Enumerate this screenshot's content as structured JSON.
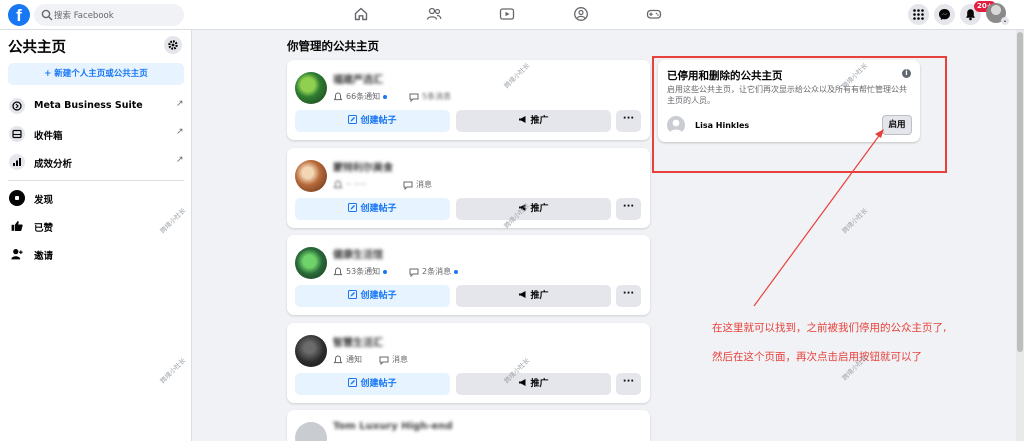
{
  "header": {
    "search_placeholder": "搜索 Facebook",
    "notification_badge": "20+"
  },
  "sidebar": {
    "title": "公共主页",
    "new_page_label": "+ 新建个人主页或公共主页",
    "items": [
      {
        "label": "Meta Business Suite",
        "arrow": "↗"
      },
      {
        "label": "收件箱",
        "arrow": "↗"
      },
      {
        "label": "成效分析",
        "arrow": "↗"
      },
      {
        "label": "发现"
      },
      {
        "label": "已赞"
      },
      {
        "label": "邀请"
      }
    ]
  },
  "main": {
    "title": "你管理的公共主页",
    "create_post_label": "创建帖子",
    "promote_label": "推广",
    "more_label": "···",
    "pages": [
      {
        "name": "福建严选汇",
        "notifications": "66条通知",
        "messages": "5条消息"
      },
      {
        "name": "蒙特利尔美食",
        "notifications": "·· ·····",
        "messages": "消息"
      },
      {
        "name": "健康生活馆",
        "notifications": "53条通知",
        "messages": "2条消息"
      },
      {
        "name": "智慧生活汇",
        "notifications": "通知",
        "messages": "消息"
      },
      {
        "name": "Tom Luxury High-end"
      }
    ]
  },
  "deactivated_panel": {
    "title": "已停用和删除的公共主页",
    "info": "i",
    "description": "启用这些公共主页，让它们再次显示给公众以及所有有帮忙管理公共主页的人员。",
    "user_name": "Lisa Hinkles",
    "enable_label": "启用"
  },
  "annotation": {
    "line1": "在这里就可以找到，之前被我们停用的公众主页了,",
    "line2": "然后在这个页面，再次点击启用按钮就可以了",
    "color": "#e8413c"
  },
  "watermark": "跨境小社长",
  "colors": {
    "brand": "#1877f2",
    "background": "#f0f2f5"
  }
}
